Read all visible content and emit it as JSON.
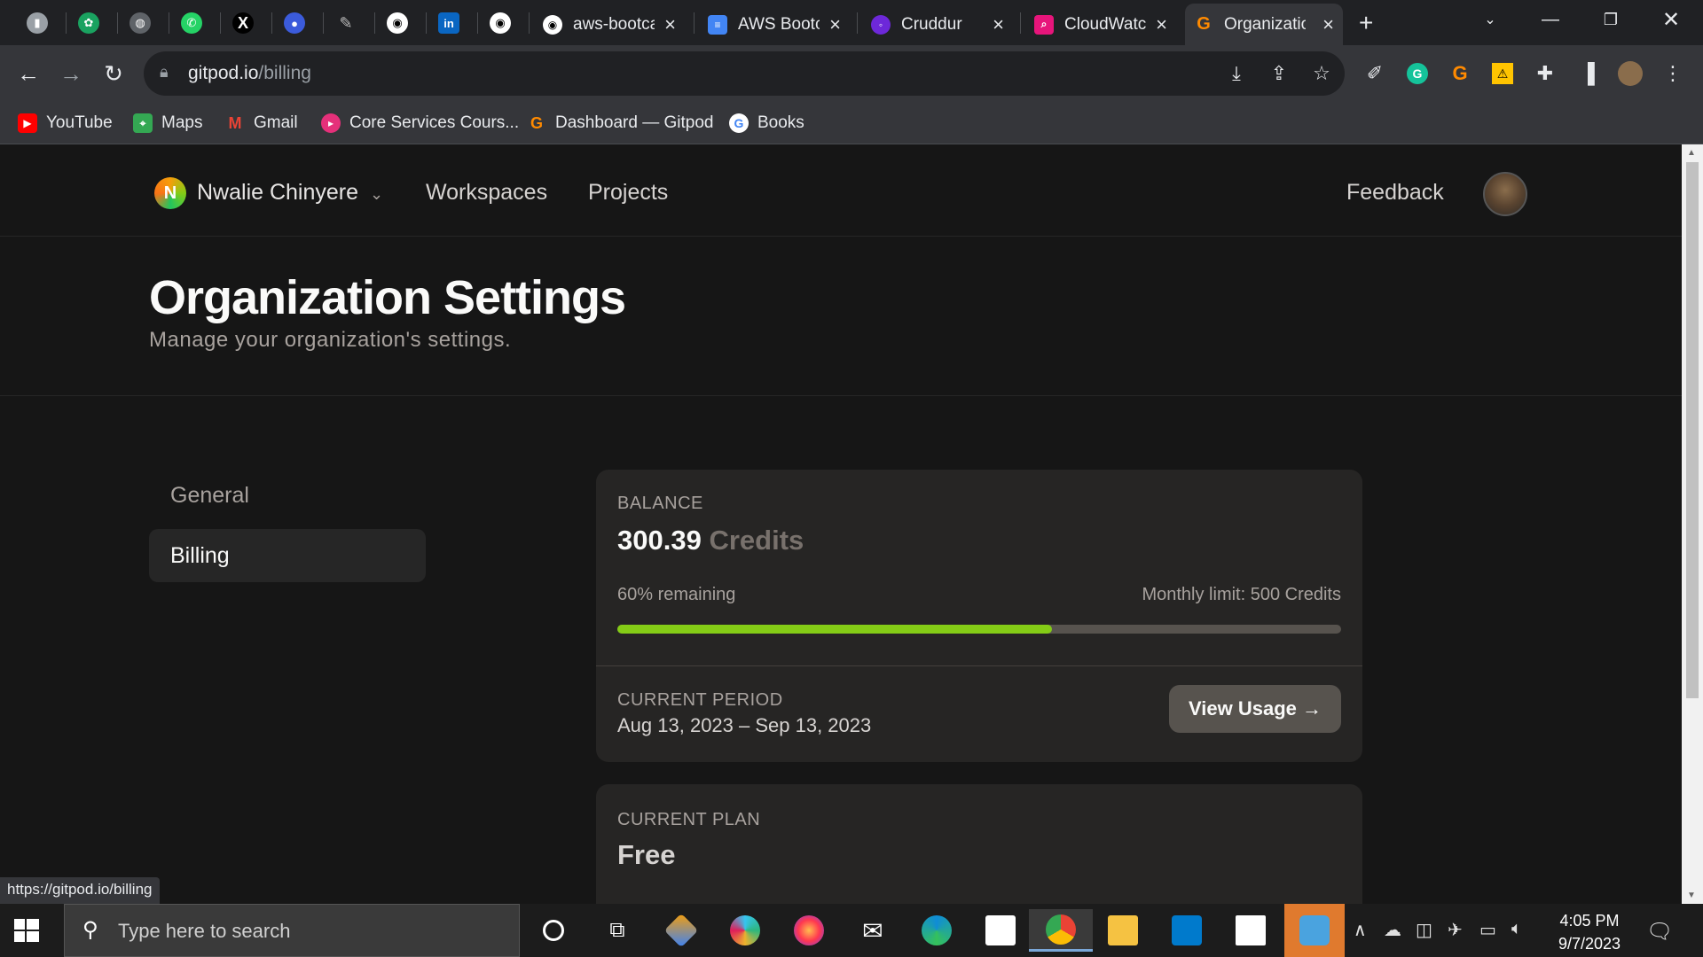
{
  "browser": {
    "tabs": [
      {
        "title": "aws-bootcamp",
        "color": "#24292f"
      },
      {
        "title": "AWS Bootcamp",
        "color": "#4285f4"
      },
      {
        "title": "Cruddur",
        "color": "#6d28d9"
      },
      {
        "title": "CloudWatch",
        "color": "#e7157b"
      },
      {
        "title": "Organization Settings",
        "color": "#ff8a00"
      }
    ],
    "url_host": "gitpod.io",
    "url_path": "/billing",
    "bookmarks": [
      "YouTube",
      "Maps",
      "Gmail",
      "Core Services Cours...",
      "Dashboard — Gitpod",
      "Books"
    ],
    "status_url": "https://gitpod.io/billing"
  },
  "app": {
    "org_initial": "N",
    "org_name": "Nwalie Chinyere",
    "nav_workspaces": "Workspaces",
    "nav_projects": "Projects",
    "feedback": "Feedback"
  },
  "header": {
    "title": "Organization Settings",
    "subtitle": "Manage your organization's settings."
  },
  "sidebar": {
    "items": [
      {
        "label": "General",
        "active": false
      },
      {
        "label": "Billing",
        "active": true
      }
    ]
  },
  "billing": {
    "balance_label": "BALANCE",
    "balance_value": "300.39",
    "balance_unit": "Credits",
    "remaining_text": "60% remaining",
    "remaining_fraction": 0.6,
    "monthly_limit": "Monthly limit: 500 Credits",
    "period_label": "CURRENT PERIOD",
    "period_value": "Aug 13, 2023 – Sep 13, 2023",
    "view_usage": "View Usage →",
    "plan_label": "CURRENT PLAN",
    "plan_value": "Free"
  },
  "taskbar": {
    "search_placeholder": "Type here to search",
    "time": "4:05 PM",
    "date": "9/7/2023"
  },
  "colors": {
    "accent": "#84cc16",
    "background": "#161616",
    "card": "#262524"
  }
}
